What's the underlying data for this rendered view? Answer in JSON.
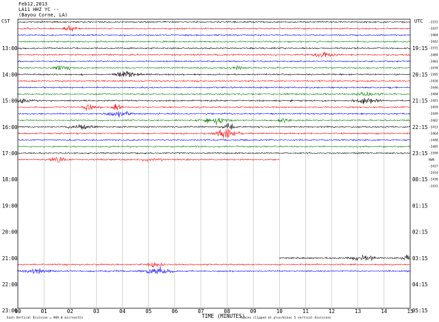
{
  "header": {
    "date": "Feb12,2013",
    "station": "LA11 HHZ YC --",
    "location": "(Bayou Corne, LA)"
  },
  "chart_data": {
    "type": "line",
    "plot_kind": "helicorder",
    "xlabel": "TIME (MINUTES)",
    "left_axis_title": "CST",
    "right_axis_title": "UTC",
    "x_ticks": [
      "00",
      "01",
      "02",
      "03",
      "04",
      "05",
      "06",
      "07",
      "08",
      "09",
      "10",
      "11",
      "12",
      "13",
      "14",
      "15"
    ],
    "xlim": [
      0,
      15
    ],
    "grid": true,
    "left_hour_labels": [
      "13:00",
      "14:00",
      "15:00",
      "16:00",
      "17:00",
      "18:00",
      "19:00",
      "20:00",
      "21:00",
      "22:00",
      "23:00"
    ],
    "right_hour_labels": [
      "19:15",
      "20:15",
      "21:15",
      "22:15",
      "23:15",
      "00:15",
      "01:15",
      "02:15",
      "03:15",
      "04:15",
      "05:15"
    ],
    "color_cycle": [
      "#000000",
      "#ff0000",
      "#0000ff",
      "#008000"
    ],
    "line_end_labels": [
      "-2331",
      "-2437",
      "-2404",
      "-2442",
      "-2372",
      "-2409",
      "-2401",
      "-2478",
      "-2395",
      "-2426",
      "-2446",
      "-2484",
      "-2441",
      "-2459",
      "-2449",
      "-2462",
      "-2413",
      "-2464",
      "-2448",
      "-2485",
      "-2399",
      "NaN",
      "-2427",
      "-2414",
      "-2436",
      "-2431"
    ],
    "partial_traces": [
      {
        "start_hour": "12:00",
        "from": 0,
        "to": 15
      },
      {
        "start_hour": "12:15",
        "from": 0,
        "to": 15
      },
      {
        "start_hour": "12:30",
        "from": 0,
        "to": 15
      },
      {
        "start_hour": "12:45",
        "from": 0,
        "to": 15
      },
      {
        "start_hour": "13:00",
        "from": 0,
        "to": 15
      },
      {
        "start_hour": "13:15",
        "from": 0,
        "to": 15
      },
      {
        "start_hour": "13:30",
        "from": 0,
        "to": 15
      },
      {
        "start_hour": "13:45",
        "from": 0,
        "to": 15
      },
      {
        "start_hour": "14:00",
        "from": 0,
        "to": 15
      },
      {
        "start_hour": "14:15",
        "from": 0,
        "to": 15
      },
      {
        "start_hour": "14:30",
        "from": 0,
        "to": 15
      },
      {
        "start_hour": "14:45",
        "from": 0,
        "to": 15
      },
      {
        "start_hour": "15:00",
        "from": 0,
        "to": 15
      },
      {
        "start_hour": "15:15",
        "from": 0,
        "to": 15
      },
      {
        "start_hour": "15:30",
        "from": 0,
        "to": 15
      },
      {
        "start_hour": "15:45",
        "from": 0,
        "to": 15
      },
      {
        "start_hour": "16:00",
        "from": 0,
        "to": 15
      },
      {
        "start_hour": "16:15",
        "from": 0,
        "to": 15
      },
      {
        "start_hour": "16:30",
        "from": 0,
        "to": 15
      },
      {
        "start_hour": "16:45",
        "from": 0,
        "to": 15
      },
      {
        "start_hour": "17:00",
        "from": 0,
        "to": 15
      },
      {
        "start_hour": "17:15",
        "from": 0,
        "to": 10
      },
      {
        "start_hour": "21:00",
        "from": 10,
        "to": 15
      },
      {
        "start_hour": "21:15",
        "from": 0,
        "to": 15
      },
      {
        "start_hour": "21:30",
        "from": 0,
        "to": 15
      }
    ],
    "footer_left": "Each Vertical Division = 969.0 microvolts",
    "footer_right": "Traces clipped at plus/minus 5 vertical divisions"
  }
}
